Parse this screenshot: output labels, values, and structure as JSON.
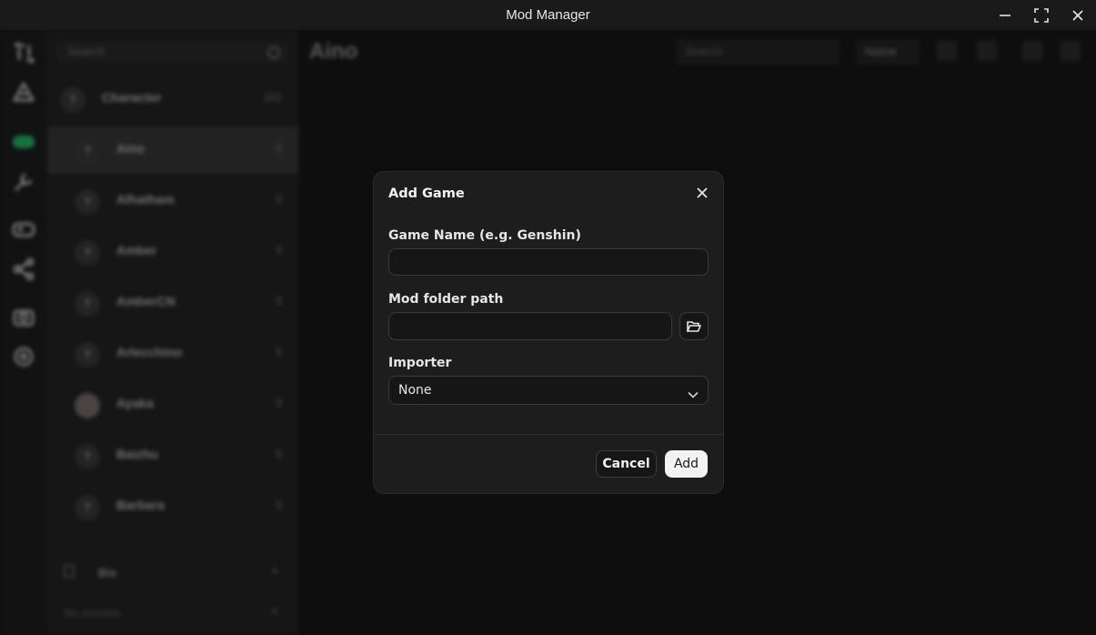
{
  "window": {
    "title": "Mod Manager"
  },
  "background": {
    "list_search_placeholder": "Search",
    "category_row": {
      "label": "Character",
      "count": "101"
    },
    "characters": [
      {
        "name": "Aino",
        "count": "0"
      },
      {
        "name": "Alhatham",
        "count": "0"
      },
      {
        "name": "Amber",
        "count": "0"
      },
      {
        "name": "AmberCN",
        "count": "0"
      },
      {
        "name": "Arlecchino",
        "count": "0"
      },
      {
        "name": "Ayaka",
        "count": "0"
      },
      {
        "name": "Baizhu",
        "count": "0"
      },
      {
        "name": "Barbara",
        "count": "0"
      }
    ],
    "bottom_preset": "Bis",
    "bottom_presets_label": "No presets",
    "main_title": "Aino",
    "main_search_placeholder": "Search",
    "sort_label": "Name"
  },
  "dialog": {
    "title": "Add Game",
    "game_name_label": "Game Name (e.g. Genshin)",
    "game_name_value": "",
    "mod_folder_label": "Mod folder path",
    "mod_folder_value": "",
    "importer_label": "Importer",
    "importer_value": "None",
    "cancel_label": "Cancel",
    "add_label": "Add"
  },
  "icons": [
    "minimize-icon",
    "maximize-icon",
    "close-icon",
    "folder-open-icon",
    "chevron-down-icon"
  ]
}
